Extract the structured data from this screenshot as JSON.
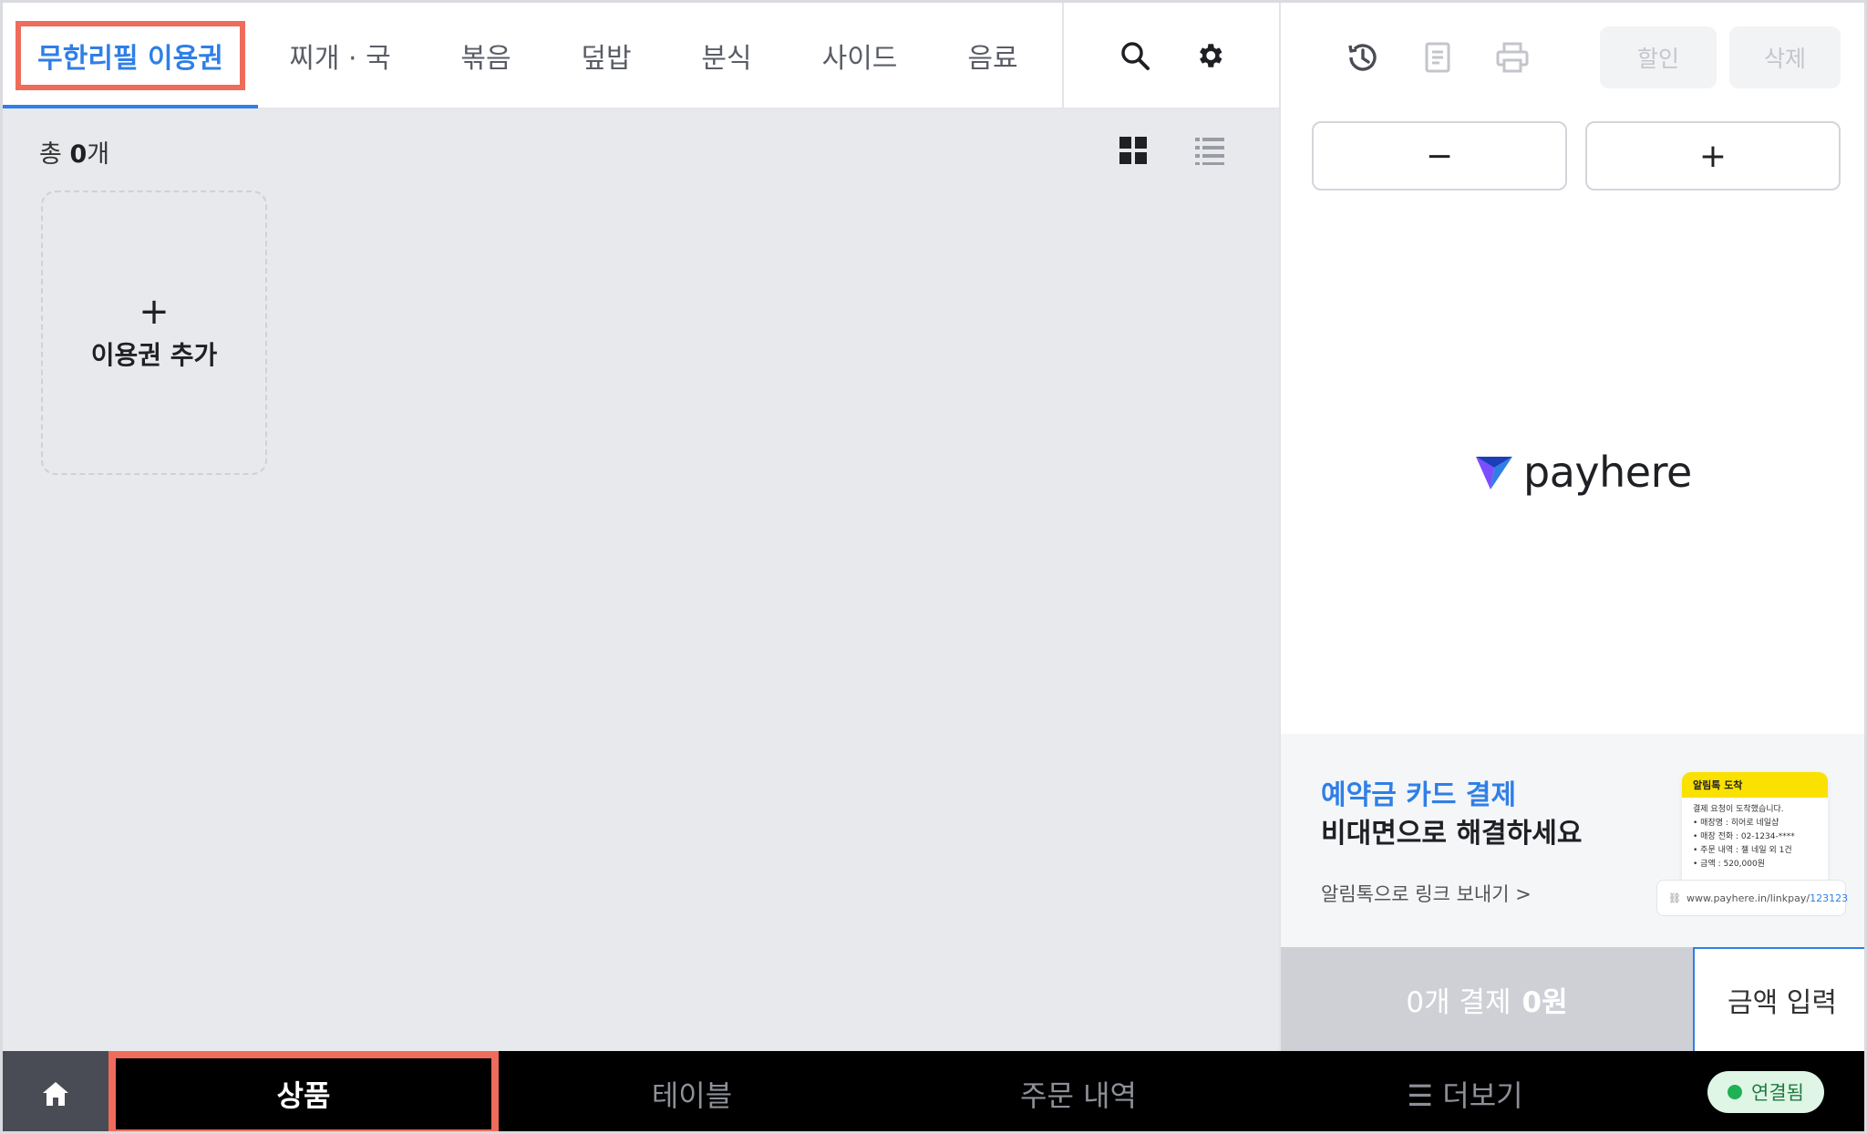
{
  "tabs": [
    {
      "label": "무한리필 이용권",
      "active": true
    },
    {
      "label": "찌개 · 국",
      "active": false
    },
    {
      "label": "볶음",
      "active": false
    },
    {
      "label": "덮밥",
      "active": false
    },
    {
      "label": "분식",
      "active": false
    },
    {
      "label": "사이드",
      "active": false
    },
    {
      "label": "음료",
      "active": false
    }
  ],
  "toolbar": {
    "search_icon": "search-icon",
    "settings_icon": "gear-icon"
  },
  "list": {
    "count_prefix": "총",
    "count_value": "0",
    "count_suffix": "개",
    "view_modes": [
      "grid-view-icon",
      "list-view-icon"
    ],
    "add_card": {
      "plus": "+",
      "label": "이용권 추가"
    }
  },
  "order_panel": {
    "icons": [
      "history-icon",
      "receipt-icon",
      "printer-icon"
    ],
    "discount_label": "할인",
    "delete_label": "삭제",
    "minus_label": "−",
    "plus_label": "+",
    "logo_text": "payhere"
  },
  "promo": {
    "title_line1": "예약금 카드 결제",
    "title_line2": "비대면으로 해결하세요",
    "link_text": "알림톡으로 링크 보내기 >",
    "card": {
      "header": "알림톡 도착",
      "lines": [
        "결제 요청이 도착했습니다.",
        "• 매장명 : 히어로 네일샵",
        "• 매장 전화 : 02-1234-****",
        "• 주문 내역 : 젤 네일 외 1건",
        "• 금액 : 520,000원"
      ],
      "url_prefix": "www.payhere.in/linkpay/",
      "url_number": "123123"
    }
  },
  "payment": {
    "count_text": "0개 결제",
    "amount_text": "0원",
    "amount_input_label": "금액 입력"
  },
  "bottom_nav": {
    "home_icon": "home-icon",
    "items": [
      {
        "label": "상품",
        "active": true
      },
      {
        "label": "테이블",
        "active": false
      },
      {
        "label": "주문 내역",
        "active": false
      },
      {
        "label": "☰ 더보기",
        "active": false
      }
    ],
    "status_label": "연결됨"
  },
  "colors": {
    "accent": "#2f7fe6",
    "highlight": "#ef6b5a",
    "status_green": "#1fb155"
  }
}
